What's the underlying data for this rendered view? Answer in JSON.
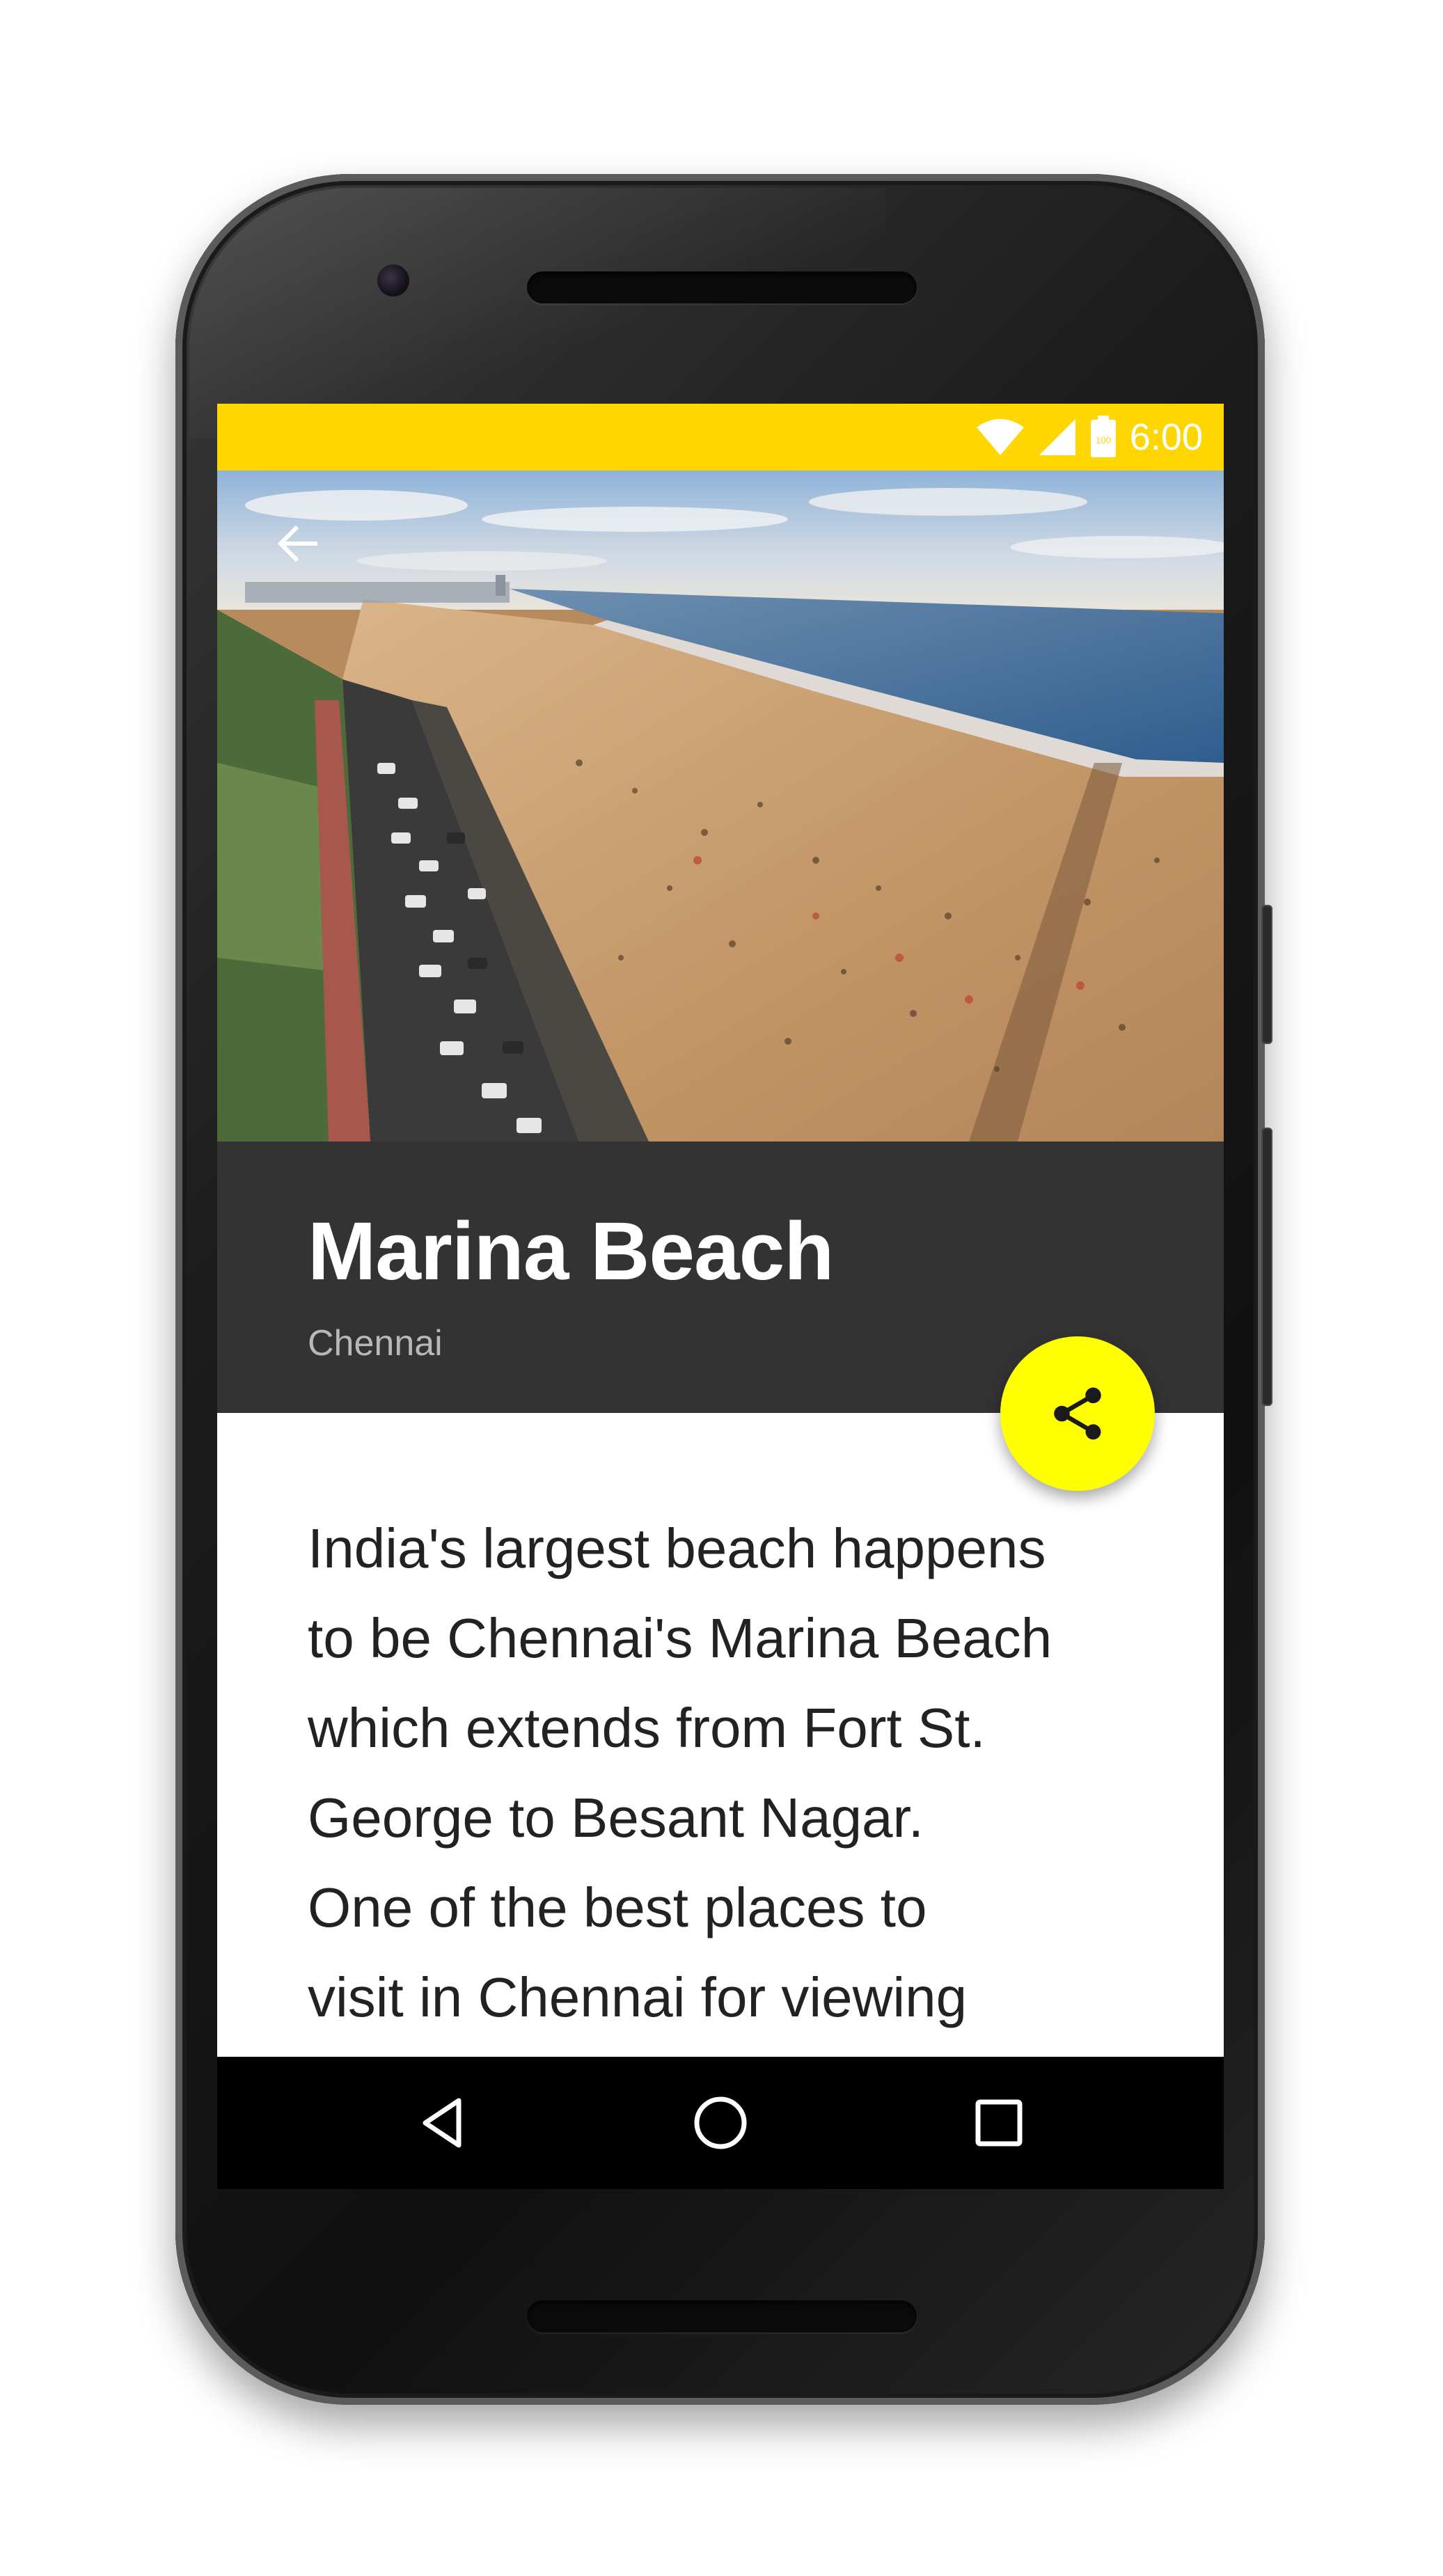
{
  "status_bar": {
    "time": "6:00",
    "battery_level": "100",
    "background_color": "#ffd600",
    "icons": [
      "wifi-icon",
      "cellular-signal-icon",
      "battery-icon"
    ]
  },
  "app_bar": {
    "back_icon": "arrow-back-icon"
  },
  "hero_image": {
    "subject": "aerial view of beach, promenade road with parked cars, and sea"
  },
  "place": {
    "title": "Marina Beach",
    "subtitle": "Chennai"
  },
  "fab": {
    "icon": "share-icon",
    "color": "#ffff00"
  },
  "description": {
    "lines": [
      "India's largest beach happens",
      "to be Chennai's Marina Beach",
      "which extends from Fort St.",
      "George to Besant Nagar.",
      "One of the best places to",
      "visit in Chennai for viewing"
    ]
  },
  "navigation_bar": {
    "buttons": [
      "back-triangle-icon",
      "home-circle-icon",
      "recents-square-icon"
    ]
  },
  "colors": {
    "accent": "#ffd600",
    "title_panel": "#333333",
    "fab": "#ffff00",
    "text": "#222222"
  }
}
